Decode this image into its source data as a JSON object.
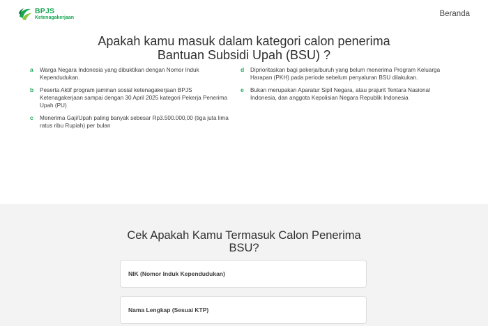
{
  "header": {
    "logo_brand": "BPJS",
    "logo_sub": "Ketenagakerjaan",
    "nav_link": "Beranda"
  },
  "title": "Apakah kamu masuk dalam kategori calon penerima Bantuan Subsidi Upah (BSU) ?",
  "criteria": [
    {
      "letter": "a",
      "text": "Warga Negara Indonesia yang dibuktikan dengan Nomor Induk Kependudukan."
    },
    {
      "letter": "b",
      "text": "Peserta Aktif program jaminan sosial ketenagakerjaan BPJS Ketenagakerjaan sampai dengan 30 April 2025 kategori Pekerja Penerima Upah (PU)"
    },
    {
      "letter": "c",
      "text": "Menerima Gaji/Upah paling banyak sebesar Rp3.500.000,00 (tiga juta lima ratus ribu Rupiah) per bulan"
    },
    {
      "letter": "d",
      "text": "Diprioritaskan bagi pekerja/buruh yang belum menerima Program Keluarga Harapan (PKH) pada periode sebelum penyaluran BSU dilakukan."
    },
    {
      "letter": "e",
      "text": "Bukan merupakan Aparatur Sipil Negara, atau prajurit Tentara Nasional Indonesia, dan anggota Kepolisian Negara Republik Indonesia"
    }
  ],
  "check": {
    "title": "Cek Apakah Kamu Termasuk Calon Penerima BSU?",
    "fields": [
      {
        "label": "NIK (Nomor Induk Kependudukan)"
      },
      {
        "label": "Nama Lengkap (Sesuai KTP)"
      }
    ]
  },
  "colors": {
    "brand_green": "#17a653",
    "letter_green": "#20a85b",
    "section_bg": "#f3f3f4"
  }
}
